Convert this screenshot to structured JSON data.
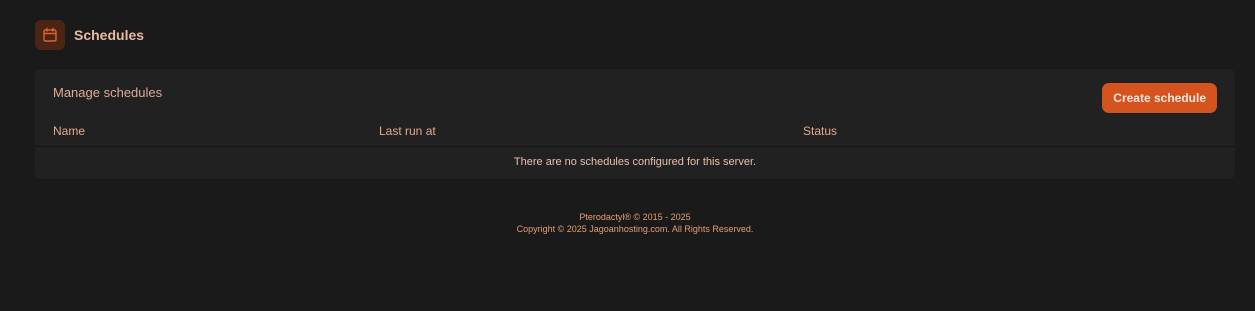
{
  "header": {
    "icon": "calendar-icon",
    "title": "Schedules"
  },
  "card": {
    "title": "Manage schedules",
    "create_button_label": "Create schedule",
    "columns": [
      "Name",
      "Last run at",
      "Status"
    ],
    "empty_message": "There are no schedules configured for this server."
  },
  "footer": {
    "line1": "Pterodactyl® © 2015 - 2025",
    "line2": "Copyright © 2025 Jagoanhosting.com. All Rights Reserved."
  },
  "colors": {
    "background": "#1a1a1a",
    "card": "#212121",
    "accent": "#d5531f",
    "icon_bg": "#4a2516"
  }
}
